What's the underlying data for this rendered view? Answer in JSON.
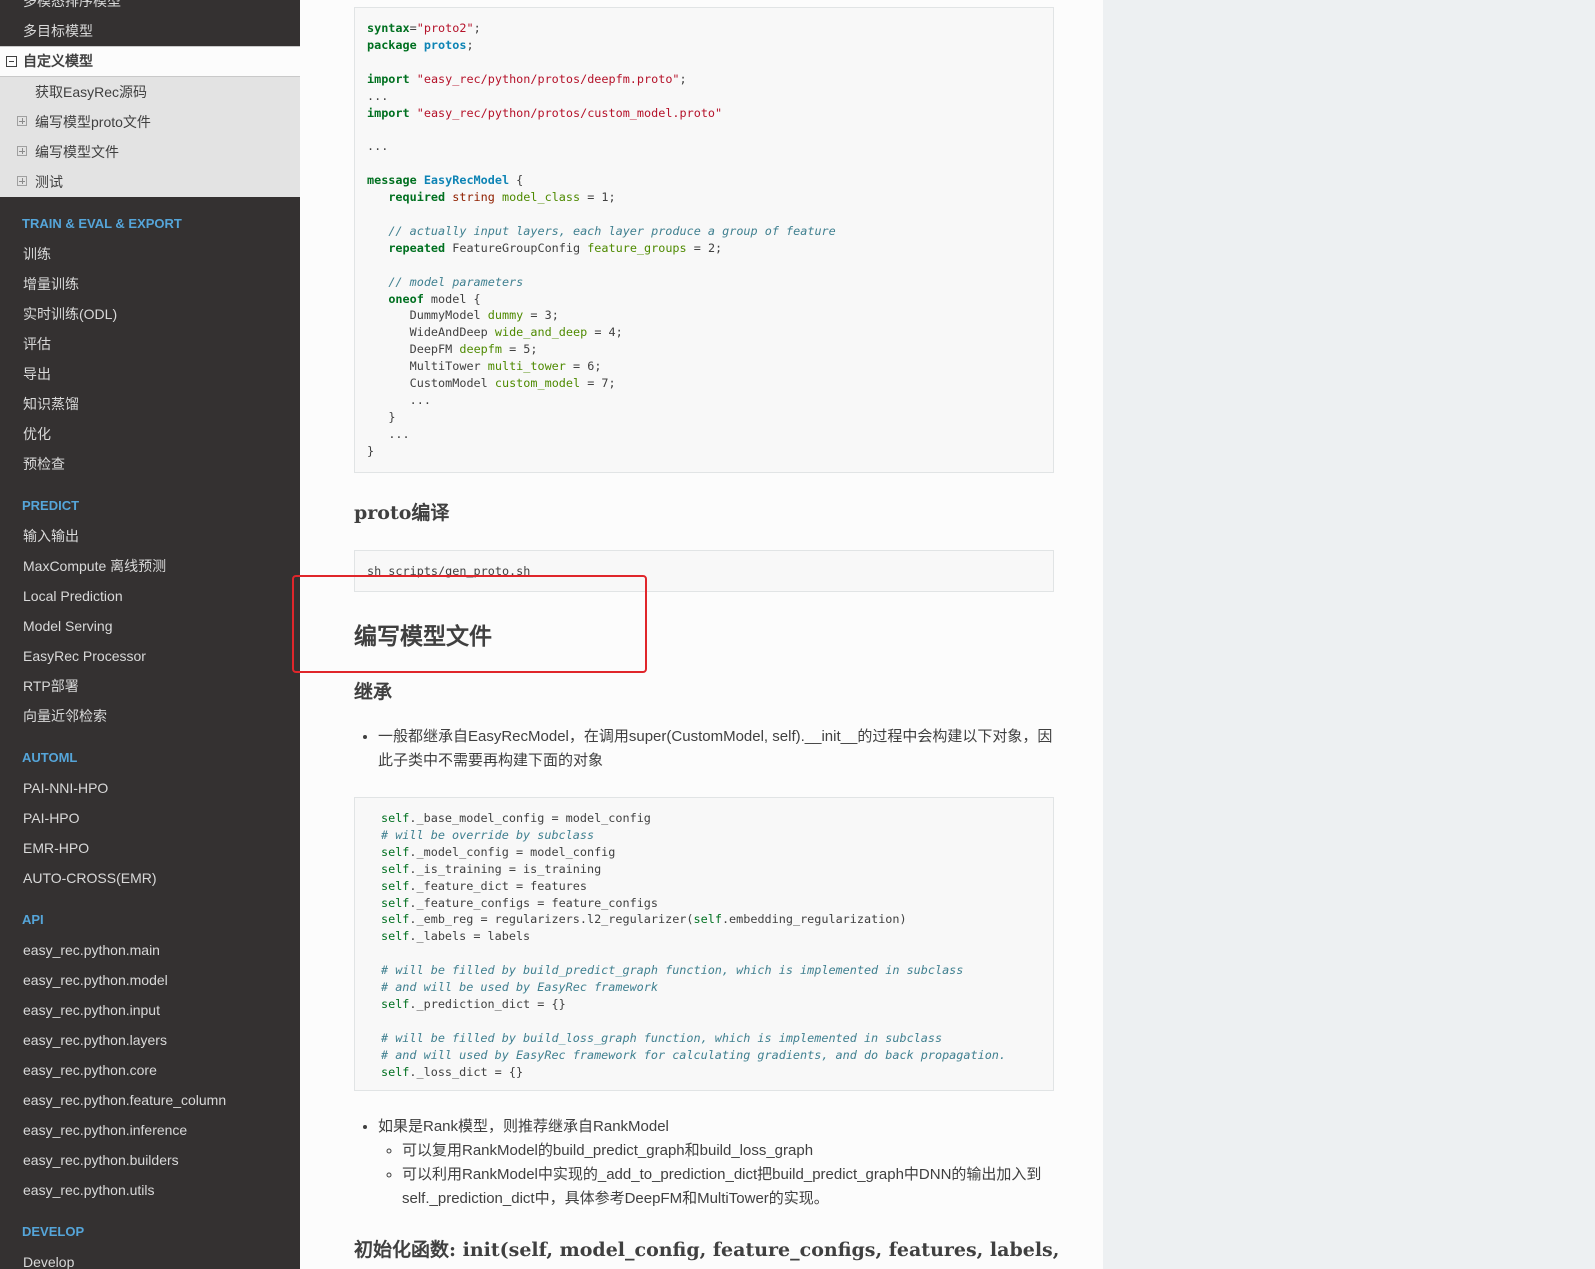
{
  "sidebar": {
    "top_items": [
      "多模态排序模型",
      "多目标模型"
    ],
    "current": {
      "label": "自定义模型"
    },
    "subitems": [
      {
        "label": "获取EasyRec源码",
        "expandable": false
      },
      {
        "label": "编写模型proto文件",
        "expandable": true
      },
      {
        "label": "编写模型文件",
        "expandable": true
      },
      {
        "label": "测试",
        "expandable": true
      }
    ],
    "sections": [
      {
        "caption": "TRAIN & EVAL & EXPORT",
        "items": [
          "训练",
          "增量训练",
          "实时训练(ODL)",
          "评估",
          "导出",
          "知识蒸馏",
          "优化",
          "预检查"
        ]
      },
      {
        "caption": "PREDICT",
        "items": [
          "输入输出",
          "MaxCompute 离线预测",
          "Local Prediction",
          "Model Serving",
          "EasyRec Processor",
          "RTP部署",
          "向量近邻检索"
        ]
      },
      {
        "caption": "AUTOML",
        "items": [
          "PAI-NNI-HPO",
          "PAI-HPO",
          "EMR-HPO",
          "AUTO-CROSS(EMR)"
        ]
      },
      {
        "caption": "API",
        "items": [
          "easy_rec.python.main",
          "easy_rec.python.model",
          "easy_rec.python.input",
          "easy_rec.python.layers",
          "easy_rec.python.core",
          "easy_rec.python.feature_column",
          "easy_rec.python.inference",
          "easy_rec.python.builders",
          "easy_rec.python.utils"
        ]
      },
      {
        "caption": "DEVELOP",
        "items": [
          "Develop"
        ]
      }
    ]
  },
  "content": {
    "proto_code": {
      "l1_kw": "syntax",
      "l1_eq": "=",
      "l1_str": "\"proto2\"",
      "l1_end": ";",
      "l2_kw": "package",
      "l2_name": "protos",
      "l2_end": ";",
      "l3_kw": "import",
      "l3_str": "\"easy_rec/python/protos/deepfm.proto\"",
      "l3_end": ";",
      "l4": "...",
      "l5_kw": "import",
      "l5_str": "\"easy_rec/python/protos/custom_model.proto\"",
      "l6": "...",
      "l7_kw": "message",
      "l7_cls": "EasyRecModel",
      "l7_end": " {",
      "l8_kw": "required",
      "l8_ty": "string",
      "l8_fld": "model_class",
      "l8_end": " = 1;",
      "l9_cm": "// actually input layers, each layer produce a group of feature",
      "l10_kw": "repeated",
      "l10_ty": "FeatureGroupConfig",
      "l10_fld": "feature_groups",
      "l10_end": " = 2;",
      "l11_cm": "// model parameters",
      "l12_kw": "oneof",
      "l12_rest": " model {",
      "models": [
        {
          "type": "DummyModel",
          "field": "dummy",
          "num": " = 3;"
        },
        {
          "type": "WideAndDeep",
          "field": "wide_and_deep",
          "num": " = 4;"
        },
        {
          "type": "DeepFM",
          "field": "deepfm",
          "num": " = 5;"
        },
        {
          "type": "MultiTower",
          "field": "multi_tower",
          "num": " = 6;"
        },
        {
          "type": "CustomModel",
          "field": "custom_model",
          "num": " = 7;"
        }
      ],
      "l18": "...",
      "l19": "}",
      "l20": "...",
      "l21": "}"
    },
    "h_proto_compile": "proto编译",
    "compile_cmd": "sh scripts/gen_proto.sh",
    "h_write_model": "编写模型文件",
    "h_inherit": "继承",
    "bullet1": "一般都继承自EasyRecModel，在调用super(CustomModel, self).__init__的过程中会构建以下对象，因此子类中不需要再构建下面的对象",
    "init_code": [
      {
        "self": "self",
        "rest": "._base_model_config = model_config"
      },
      {
        "cm": "# will be override by subclass"
      },
      {
        "self": "self",
        "rest": "._model_config = model_config"
      },
      {
        "self": "self",
        "rest": "._is_training = is_training"
      },
      {
        "self": "self",
        "rest": "._feature_dict = features"
      },
      {
        "self": "self",
        "rest": "._feature_configs = feature_configs"
      },
      {
        "self": "self",
        "rest": "._emb_reg = regularizers.l2_regularizer(",
        "self2": "self",
        "rest2": ".embedding_regularization)"
      },
      {
        "self": "self",
        "rest": "._labels = labels"
      },
      {
        "blank": ""
      },
      {
        "cm": "# will be filled by build_predict_graph function, which is implemented in subclass"
      },
      {
        "cm": "# and will be used by EasyRec framework"
      },
      {
        "self": "self",
        "rest": "._prediction_dict = {}"
      },
      {
        "blank": ""
      },
      {
        "cm": "# will be filled by build_loss_graph function, which is implemented in subclass"
      },
      {
        "cm": "# and will used by EasyRec framework for calculating gradients, and do back propagation."
      },
      {
        "self": "self",
        "rest": "._loss_dict = {}"
      }
    ],
    "bullet2": "如果是Rank模型，则推荐继承自RankModel",
    "sub1": "可以复用RankModel的build_predict_graph和build_loss_graph",
    "sub2": "可以利用RankModel中实现的_add_to_prediction_dict把build_predict_graph中DNN的输出加入到self._prediction_dict中，具体参考DeepFM和MultiTower的实现。",
    "h_init": "初始化函数: init(self, model_config, feature_configs, features, labels,"
  },
  "colors": {
    "sidebar_bg": "#343131",
    "caption": "#55a5d9",
    "highlight_border": "#e0262b"
  }
}
